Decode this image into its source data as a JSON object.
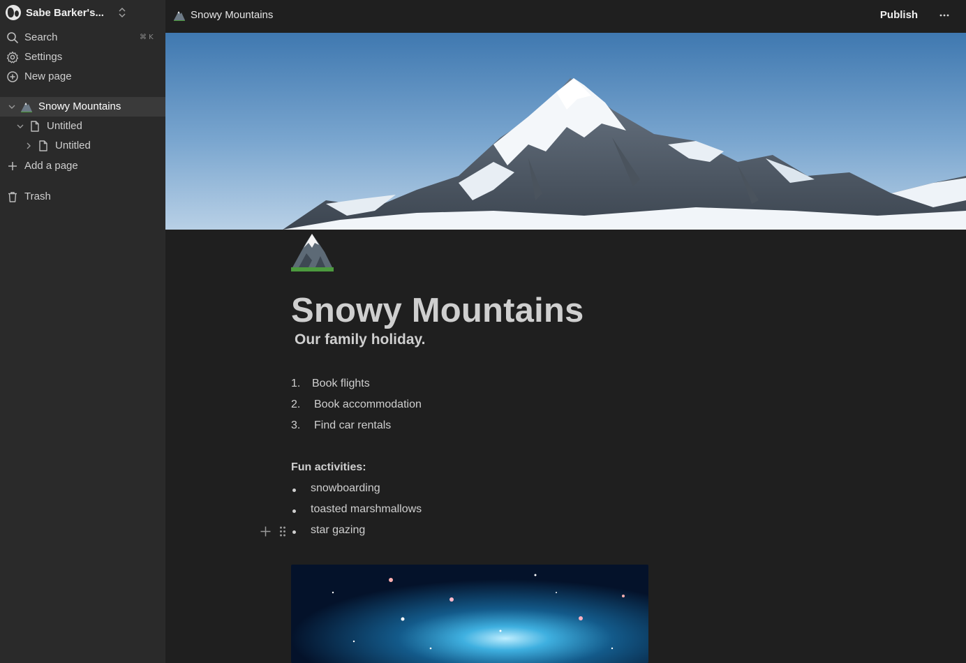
{
  "workspace": {
    "name": "Sabe Barker's..."
  },
  "sidebar": {
    "search_label": "Search",
    "search_shortcut": "⌘ K",
    "settings_label": "Settings",
    "new_page_label": "New page",
    "tree": [
      {
        "label": "Snowy Mountains",
        "icon": "mountain-icon",
        "expanded": true,
        "active": true
      },
      {
        "label": "Untitled",
        "icon": "page-icon",
        "expanded": true
      },
      {
        "label": "Untitled",
        "icon": "page-icon",
        "expanded": false
      }
    ],
    "add_page_label": "Add a page",
    "trash_label": "Trash"
  },
  "topbar": {
    "breadcrumb": "Snowy Mountains",
    "publish_label": "Publish",
    "more_icon": "more-horizontal-icon"
  },
  "page": {
    "title": "Snowy Mountains",
    "subtitle": "Our family holiday.",
    "numbered_list": [
      {
        "num": "1.",
        "text": "Book flights"
      },
      {
        "num": "2.",
        "text": "Book accommodation"
      },
      {
        "num": "3.",
        "text": "Find car rentals"
      }
    ],
    "activities_heading": "Fun activities:",
    "bullets": [
      "snowboarding",
      "toasted marshmallows",
      "star gazing"
    ]
  },
  "colors": {
    "background": "#1f1f1f",
    "sidebar": "#2a2a2a",
    "sidebar_active": "#3a3a3a",
    "text": "#cfcfcf"
  }
}
